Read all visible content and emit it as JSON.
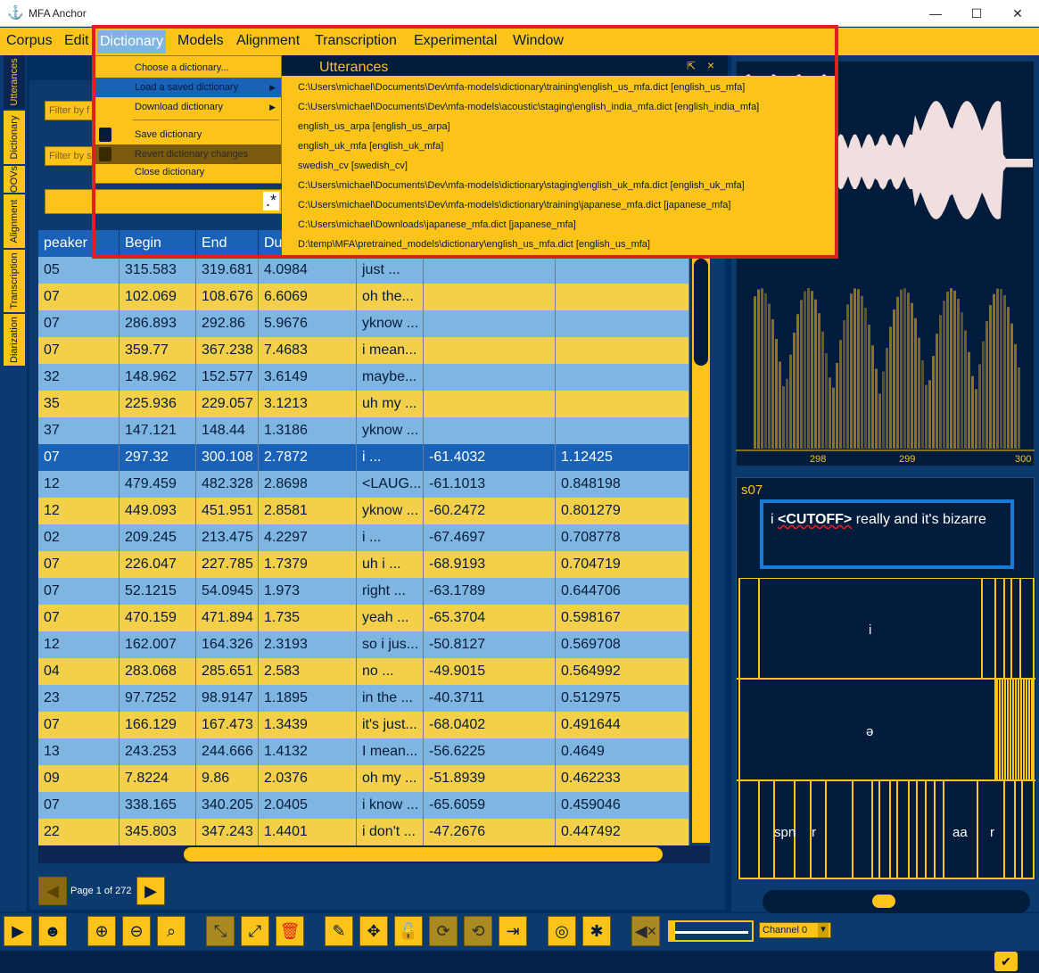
{
  "window": {
    "title": "MFA Anchor",
    "minimize": "—",
    "maximize": "☐",
    "close": "✕"
  },
  "menubar": [
    "Corpus",
    "Edit",
    "Dictionary",
    "Models",
    "Alignment",
    "Transcription",
    "Experimental",
    "Window"
  ],
  "vtabs": [
    "Utterances",
    "Dictionary",
    "OOVs",
    "Alignment",
    "Transcription",
    "Diarization"
  ],
  "dictionary_menu": {
    "items": [
      "Choose a dictionary...",
      "Load a saved dictionary",
      "Download dictionary",
      "Save dictionary",
      "Revert dictionary changes",
      "Close dictionary"
    ],
    "arrow": "▶"
  },
  "saved_dictionaries": [
    "C:\\Users\\michael\\Documents\\Dev\\mfa-models\\dictionary\\training\\english_us_mfa.dict [english_us_mfa]",
    "C:\\Users\\michael\\Documents\\Dev\\mfa-models\\acoustic\\staging\\english_india_mfa.dict [english_india_mfa]",
    "english_us_arpa [english_us_arpa]",
    "english_uk_mfa [english_uk_mfa]",
    "swedish_cv [swedish_cv]",
    "C:\\Users\\michael\\Documents\\Dev\\mfa-models\\dictionary\\staging\\english_uk_mfa.dict [english_uk_mfa]",
    "C:\\Users\\michael\\Documents\\Dev\\mfa-models\\dictionary\\training\\japanese_mfa.dict [japanese_mfa]",
    "C:\\Users\\michael\\Downloads\\japanese_mfa.dict [japanese_mfa]",
    "D:\\temp\\MFA\\pretrained_models\\dictionary\\english_us_mfa.dict [english_us_mfa]"
  ],
  "utterances_panel": {
    "title": "Utterances",
    "float": "⇱",
    "close": "×"
  },
  "filters": {
    "filter1": "Filter by f",
    "filter2": "Filter by s",
    "regex": ".*"
  },
  "table": {
    "headers": [
      "peaker",
      "Begin",
      "End",
      "Du",
      "",
      "",
      ""
    ],
    "rows": [
      [
        "05",
        "315.583",
        "319.681",
        "4.0984",
        "just ...",
        "",
        ""
      ],
      [
        "07",
        "102.069",
        "108.676",
        "6.6069",
        "oh the...",
        "",
        ""
      ],
      [
        "07",
        "286.893",
        "292.86",
        "5.9676",
        "yknow ...",
        "",
        ""
      ],
      [
        "07",
        "359.77",
        "367.238",
        "7.4683",
        "i mean...",
        "",
        ""
      ],
      [
        "32",
        "148.962",
        "152.577",
        "3.6149",
        "maybe...",
        "",
        ""
      ],
      [
        "35",
        "225.936",
        "229.057",
        "3.1213",
        "uh my ...",
        "",
        ""
      ],
      [
        "37",
        "147.121",
        "148.44",
        "1.3186",
        "yknow ...",
        "",
        ""
      ],
      [
        "07",
        "297.32",
        "300.108",
        "2.7872",
        "i ...",
        "-61.4032",
        "1.12425"
      ],
      [
        "12",
        "479.459",
        "482.328",
        "2.8698",
        "<LAUG...",
        "-61.1013",
        "0.848198"
      ],
      [
        "12",
        "449.093",
        "451.951",
        "2.8581",
        "yknow ...",
        "-60.2472",
        "0.801279"
      ],
      [
        "02",
        "209.245",
        "213.475",
        "4.2297",
        "i ...",
        "-67.4697",
        "0.708778"
      ],
      [
        "07",
        "226.047",
        "227.785",
        "1.7379",
        "uh i ...",
        "-68.9193",
        "0.704719"
      ],
      [
        "07",
        "52.1215",
        "54.0945",
        "1.973",
        "right ...",
        "-63.1789",
        "0.644706"
      ],
      [
        "07",
        "470.159",
        "471.894",
        "1.735",
        "yeah ...",
        "-65.3704",
        "0.598167"
      ],
      [
        "12",
        "162.007",
        "164.326",
        "2.3193",
        "so i jus...",
        "-50.8127",
        "0.569708"
      ],
      [
        "04",
        "283.068",
        "285.651",
        "2.583",
        "no ...",
        "-49.9015",
        "0.564992"
      ],
      [
        "23",
        "97.7252",
        "98.9147",
        "1.1895",
        "in the ...",
        "-40.3711",
        "0.512975"
      ],
      [
        "07",
        "166.129",
        "167.473",
        "1.3439",
        "it's just...",
        "-68.0402",
        "0.491644"
      ],
      [
        "13",
        "243.253",
        "244.666",
        "1.4132",
        "I mean...",
        "-56.6225",
        "0.4649"
      ],
      [
        "09",
        "7.8224",
        "9.86",
        "2.0376",
        "oh my ...",
        "-51.8939",
        "0.462233"
      ],
      [
        "07",
        "338.165",
        "340.205",
        "2.0405",
        "i know ...",
        "-65.6059",
        "0.459046"
      ],
      [
        "22",
        "345.803",
        "347.243",
        "1.4401",
        "i don't ...",
        "-47.2676",
        "0.447492"
      ]
    ]
  },
  "pagination": {
    "label": "Page 1 of 272",
    "prev": "◀",
    "next": "▶"
  },
  "waveform": {
    "ticks": [
      "298",
      "299",
      "300"
    ]
  },
  "utterance_detail": {
    "speaker": "s07",
    "text_prefix": "i ",
    "cutoff": "<CUTOFF>",
    "text_suffix": " really and it's bizarre",
    "word_tier": "i",
    "phone_tier": "ə",
    "bottom_labels": [
      "spn",
      "r",
      "aa",
      "r"
    ]
  },
  "channel": {
    "label": "Channel 0",
    "arrow": "▾"
  },
  "colors": {
    "accent": "#fcc319",
    "background": "#012e5e",
    "selection": "#1a62b8",
    "highlight_box": "#e02020"
  }
}
